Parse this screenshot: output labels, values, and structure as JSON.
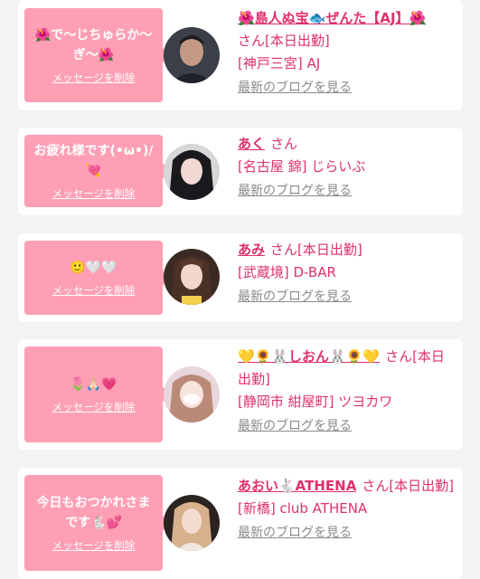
{
  "entries": [
    {
      "message": "🌺で〜じちゅらか〜ぎ〜🌺",
      "delete_label": "メッセージを削除",
      "name": "🌺島人ぬ宝🐟ぜんた【AJ】🌺",
      "san": "さん[本日出勤]",
      "area": "[神戸三宮] AJ",
      "blog_label": "最新のブログを見る"
    },
    {
      "message": "お疲れ様です(•ω•)/💘",
      "delete_label": "メッセージを削除",
      "name": "あく",
      "san": "さん",
      "area": "[名古屋 錦] じらいぶ",
      "blog_label": "最新のブログを見る"
    },
    {
      "message": "🙂🤍🤍",
      "delete_label": "メッセージを削除",
      "name": "あみ",
      "san": "さん[本日出勤]",
      "area": "[武蔵境] D-BAR",
      "blog_label": "最新のブログを見る"
    },
    {
      "message": "🌷🙏🏻💗",
      "delete_label": "メッセージを削除",
      "name": "💛🌻🐰しおん🐰🌻💛",
      "san": "さん[本日出勤]",
      "area": "[静岡市 紺屋町] ツヨカワ",
      "blog_label": "最新のブログを見る"
    },
    {
      "message": "今日もおつかれさまです🐇💕",
      "delete_label": "メッセージを削除",
      "name": "あおい🐇ATHENA",
      "san": "さん[本日出勤]",
      "area": "[新橋] club ATHENA",
      "blog_label": "最新のブログを見る"
    }
  ]
}
